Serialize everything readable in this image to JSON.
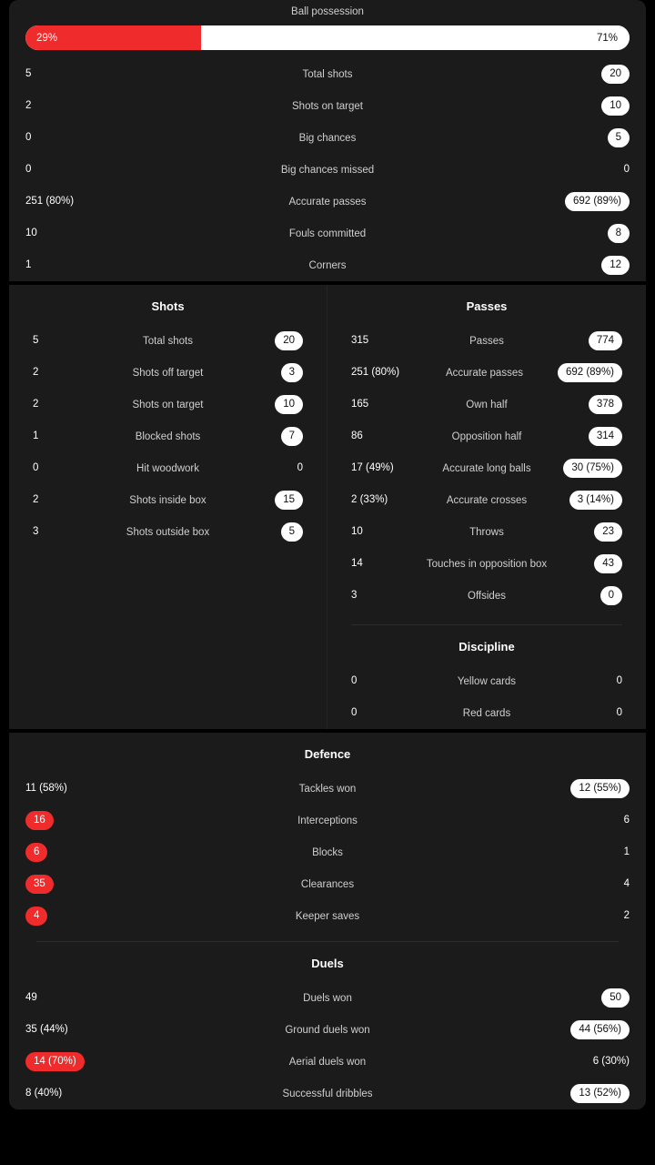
{
  "possession": {
    "title": "Ball possession",
    "home_pct": 29,
    "away_pct": 71,
    "home_label": "29%",
    "away_label": "71%"
  },
  "colors": {
    "accent_red": "#ef2b2b",
    "pill_white": "#ffffff",
    "card_bg": "#1b1b1b",
    "page_bg": "#000000"
  },
  "overview": {
    "rows": [
      {
        "label": "Total shots",
        "home": "5",
        "away": "20",
        "home_style": "plain",
        "away_style": "pill-white"
      },
      {
        "label": "Shots on target",
        "home": "2",
        "away": "10",
        "home_style": "plain",
        "away_style": "pill-white"
      },
      {
        "label": "Big chances",
        "home": "0",
        "away": "5",
        "home_style": "plain",
        "away_style": "pill-white"
      },
      {
        "label": "Big chances missed",
        "home": "0",
        "away": "0",
        "home_style": "plain",
        "away_style": "plain"
      },
      {
        "label": "Accurate passes",
        "home": "251 (80%)",
        "away": "692 (89%)",
        "home_style": "plain",
        "away_style": "pill-white"
      },
      {
        "label": "Fouls committed",
        "home": "10",
        "away": "8",
        "home_style": "plain",
        "away_style": "pill-white"
      },
      {
        "label": "Corners",
        "home": "1",
        "away": "12",
        "home_style": "plain",
        "away_style": "pill-white"
      }
    ]
  },
  "shots": {
    "title": "Shots",
    "rows": [
      {
        "label": "Total shots",
        "home": "5",
        "away": "20",
        "home_style": "plain",
        "away_style": "pill-white"
      },
      {
        "label": "Shots off target",
        "home": "2",
        "away": "3",
        "home_style": "plain",
        "away_style": "pill-white"
      },
      {
        "label": "Shots on target",
        "home": "2",
        "away": "10",
        "home_style": "plain",
        "away_style": "pill-white"
      },
      {
        "label": "Blocked shots",
        "home": "1",
        "away": "7",
        "home_style": "plain",
        "away_style": "pill-white"
      },
      {
        "label": "Hit woodwork",
        "home": "0",
        "away": "0",
        "home_style": "plain",
        "away_style": "plain"
      },
      {
        "label": "Shots inside box",
        "home": "2",
        "away": "15",
        "home_style": "plain",
        "away_style": "pill-white"
      },
      {
        "label": "Shots outside box",
        "home": "3",
        "away": "5",
        "home_style": "plain",
        "away_style": "pill-white"
      }
    ]
  },
  "passes": {
    "title": "Passes",
    "rows": [
      {
        "label": "Passes",
        "home": "315",
        "away": "774",
        "home_style": "plain",
        "away_style": "pill-white"
      },
      {
        "label": "Accurate passes",
        "home": "251 (80%)",
        "away": "692 (89%)",
        "home_style": "plain",
        "away_style": "pill-white"
      },
      {
        "label": "Own half",
        "home": "165",
        "away": "378",
        "home_style": "plain",
        "away_style": "pill-white"
      },
      {
        "label": "Opposition half",
        "home": "86",
        "away": "314",
        "home_style": "plain",
        "away_style": "pill-white"
      },
      {
        "label": "Accurate long balls",
        "home": "17 (49%)",
        "away": "30 (75%)",
        "home_style": "plain",
        "away_style": "pill-white"
      },
      {
        "label": "Accurate crosses",
        "home": "2 (33%)",
        "away": "3 (14%)",
        "home_style": "plain",
        "away_style": "pill-white"
      },
      {
        "label": "Throws",
        "home": "10",
        "away": "23",
        "home_style": "plain",
        "away_style": "pill-white"
      },
      {
        "label": "Touches in opposition box",
        "home": "14",
        "away": "43",
        "home_style": "plain",
        "away_style": "pill-white"
      },
      {
        "label": "Offsides",
        "home": "3",
        "away": "0",
        "home_style": "plain",
        "away_style": "pill-white"
      }
    ]
  },
  "discipline": {
    "title": "Discipline",
    "rows": [
      {
        "label": "Yellow cards",
        "home": "0",
        "away": "0",
        "home_style": "plain",
        "away_style": "plain"
      },
      {
        "label": "Red cards",
        "home": "0",
        "away": "0",
        "home_style": "plain",
        "away_style": "plain"
      }
    ]
  },
  "defence": {
    "title": "Defence",
    "rows": [
      {
        "label": "Tackles won",
        "home": "11 (58%)",
        "away": "12 (55%)",
        "home_style": "plain",
        "away_style": "pill-white"
      },
      {
        "label": "Interceptions",
        "home": "16",
        "away": "6",
        "home_style": "pill-red",
        "away_style": "plain"
      },
      {
        "label": "Blocks",
        "home": "6",
        "away": "1",
        "home_style": "pill-red",
        "away_style": "plain"
      },
      {
        "label": "Clearances",
        "home": "35",
        "away": "4",
        "home_style": "pill-red",
        "away_style": "plain"
      },
      {
        "label": "Keeper saves",
        "home": "4",
        "away": "2",
        "home_style": "pill-red",
        "away_style": "plain"
      }
    ]
  },
  "duels": {
    "title": "Duels",
    "rows": [
      {
        "label": "Duels won",
        "home": "49",
        "away": "50",
        "home_style": "plain",
        "away_style": "pill-white"
      },
      {
        "label": "Ground duels won",
        "home": "35 (44%)",
        "away": "44 (56%)",
        "home_style": "plain",
        "away_style": "pill-white"
      },
      {
        "label": "Aerial duels won",
        "home": "14 (70%)",
        "away": "6 (30%)",
        "home_style": "pill-red",
        "away_style": "plain"
      },
      {
        "label": "Successful dribbles",
        "home": "8 (40%)",
        "away": "13 (52%)",
        "home_style": "plain",
        "away_style": "pill-white"
      }
    ]
  }
}
